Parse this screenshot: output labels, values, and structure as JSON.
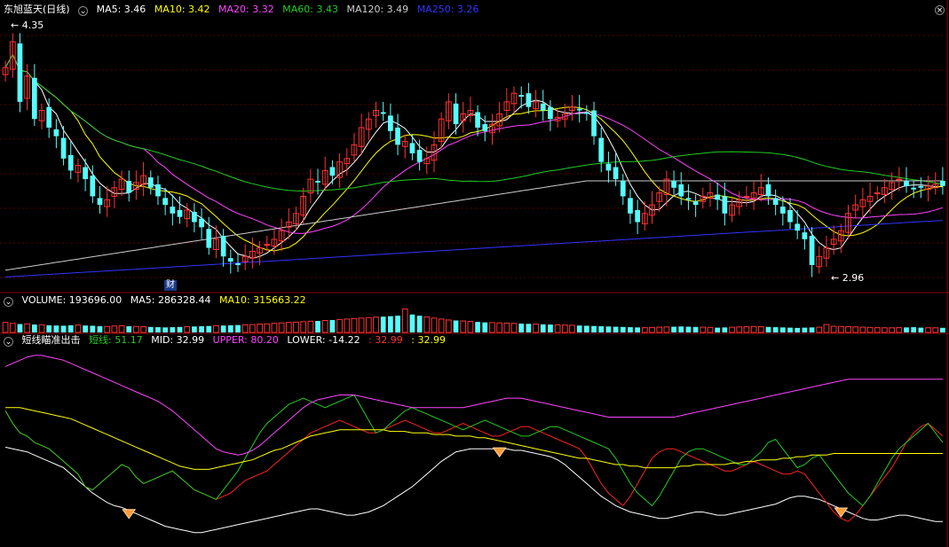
{
  "colors": {
    "up": "#ff3333",
    "down": "#55ffff",
    "ma5": "#ffffff",
    "ma10": "#ffff00",
    "ma20": "#ff44ff",
    "ma60": "#22cc22",
    "ma120": "#cccccc",
    "ma250": "#3333ff",
    "grid": "#5a0000",
    "border": "#8b0000"
  },
  "price_header": {
    "title": "东旭蓝天",
    "period": "(日线)",
    "ma5": "MA5: 3.46",
    "ma10": "MA10: 3.42",
    "ma20": "MA20: 3.32",
    "ma60": "MA60: 3.43",
    "ma120": "MA120: 3.49",
    "ma250": "MA250: 3.26"
  },
  "price_annotations": {
    "high": "4.35",
    "low": "2.96",
    "finance_badge": "财"
  },
  "volume_header": {
    "volume": "VOLUME: 193696.00",
    "ma5": "MA5: 286328.44",
    "ma10": "MA10: 315663.22"
  },
  "indicator_header": {
    "name": "短线瞄准出击",
    "short": "短线: 51.17",
    "mid": "MID: 32.99",
    "upper": "UPPER: 80.20",
    "lower": "LOWER: -14.22",
    "v1": ": 32.99",
    "v2": ": 32.99"
  },
  "chart_data": [
    {
      "type": "candlestick",
      "panel": "price",
      "ylim": [
        2.85,
        4.45
      ],
      "count": 130,
      "close": [
        4.15,
        4.3,
        3.95,
        4.1,
        3.85,
        3.9,
        3.8,
        3.75,
        3.62,
        3.55,
        3.58,
        3.5,
        3.4,
        3.35,
        3.38,
        3.45,
        3.5,
        3.42,
        3.48,
        3.52,
        3.45,
        3.4,
        3.35,
        3.3,
        3.28,
        3.32,
        3.25,
        3.22,
        3.1,
        3.15,
        3.05,
        3.02,
        3.0,
        3.05,
        3.08,
        3.1,
        3.12,
        3.15,
        3.2,
        3.25,
        3.3,
        3.4,
        3.5,
        3.48,
        3.55,
        3.52,
        3.6,
        3.62,
        3.7,
        3.8,
        3.85,
        3.9,
        3.88,
        3.78,
        3.7,
        3.72,
        3.65,
        3.6,
        3.62,
        3.7,
        3.85,
        3.95,
        3.82,
        3.88,
        3.9,
        3.8,
        3.78,
        3.82,
        3.88,
        3.95,
        4.0,
        3.98,
        3.92,
        3.95,
        3.9,
        3.85,
        3.86,
        3.88,
        3.92,
        3.9,
        3.88,
        3.75,
        3.6,
        3.55,
        3.5,
        3.4,
        3.3,
        3.25,
        3.3,
        3.35,
        3.42,
        3.5,
        3.45,
        3.4,
        3.38,
        3.35,
        3.4,
        3.42,
        3.38,
        3.3,
        3.35,
        3.38,
        3.4,
        3.42,
        3.45,
        3.4,
        3.35,
        3.3,
        3.25,
        3.2,
        3.15,
        3.0,
        3.05,
        3.1,
        3.15,
        3.2,
        3.3,
        3.35,
        3.38,
        3.4,
        3.42,
        3.45,
        3.48,
        3.5,
        3.46,
        3.44,
        3.45,
        3.46,
        3.47,
        3.46
      ],
      "annotations": {
        "high": 4.35,
        "low": 2.96
      }
    },
    {
      "type": "bar",
      "panel": "volume",
      "ylim": [
        0,
        1000000
      ],
      "values": [
        420000,
        380000,
        350000,
        360000,
        330000,
        320000,
        300000,
        290000,
        280000,
        300000,
        310000,
        290000,
        280000,
        260000,
        250000,
        270000,
        280000,
        260000,
        250000,
        240000,
        230000,
        220000,
        210000,
        220000,
        230000,
        240000,
        250000,
        260000,
        270000,
        280000,
        290000,
        300000,
        310000,
        320000,
        330000,
        350000,
        360000,
        380000,
        400000,
        420000,
        430000,
        450000,
        470000,
        480000,
        500000,
        520000,
        540000,
        560000,
        580000,
        600000,
        620000,
        640000,
        660000,
        680000,
        700000,
        980000,
        750000,
        700000,
        650000,
        600000,
        560000,
        520000,
        500000,
        480000,
        460000,
        440000,
        420000,
        410000,
        400000,
        390000,
        380000,
        370000,
        360000,
        350000,
        340000,
        330000,
        320000,
        310000,
        300000,
        290000,
        280000,
        270000,
        260000,
        250000,
        240000,
        230000,
        220000,
        210000,
        200000,
        210000,
        220000,
        230000,
        240000,
        250000,
        240000,
        230000,
        220000,
        210000,
        200000,
        210000,
        220000,
        230000,
        240000,
        250000,
        240000,
        230000,
        220000,
        210000,
        200000,
        190000,
        200000,
        210000,
        220000,
        330000,
        260000,
        250000,
        240000,
        230000,
        220000,
        210000,
        200000,
        195000,
        193696,
        200000,
        210000,
        220000,
        200000,
        195000,
        193696,
        193696
      ]
    },
    {
      "type": "line",
      "panel": "indicator",
      "ylim": [
        -25,
        100
      ],
      "count": 130,
      "series": [
        {
          "key": "white",
          "color": "#ffffff",
          "values": [
            37,
            36,
            35,
            34,
            32,
            30,
            28,
            26,
            24,
            20,
            16,
            12,
            8,
            5,
            2,
            0,
            -1,
            -3,
            -5,
            -7,
            -9,
            -11,
            -13,
            -14,
            -15,
            -16,
            -17,
            -17,
            -16,
            -15,
            -14,
            -13,
            -12,
            -11,
            -10,
            -9,
            -8,
            -7,
            -6,
            -5,
            -4,
            -3,
            -2,
            -2,
            -3,
            -4,
            -5,
            -6,
            -6,
            -5,
            -4,
            -2,
            0,
            3,
            6,
            9,
            12,
            16,
            20,
            24,
            28,
            31,
            34,
            35,
            36,
            36,
            36,
            36,
            36,
            36,
            35,
            35,
            34,
            33,
            32,
            31,
            29,
            26,
            22,
            18,
            14,
            10,
            6,
            3,
            0,
            -2,
            -4,
            -5,
            -6,
            -7,
            -8,
            -8,
            -7,
            -6,
            -5,
            -4,
            -4,
            -5,
            -6,
            -6,
            -5,
            -4,
            -3,
            -2,
            -1,
            0,
            1,
            3,
            5,
            6,
            6,
            5,
            4,
            2,
            0,
            -2,
            -4,
            -6,
            -8,
            -9,
            -9,
            -8,
            -7,
            -6,
            -6,
            -7,
            -8,
            -9,
            -10,
            -10
          ]
        },
        {
          "key": "red",
          "color": "#ff2222",
          "values": [
            60,
            52,
            46,
            44,
            40,
            38,
            36,
            32,
            28,
            24,
            20,
            12,
            10,
            14,
            18,
            22,
            26,
            24,
            18,
            14,
            16,
            18,
            20,
            22,
            18,
            14,
            10,
            8,
            6,
            4,
            6,
            8,
            12,
            16,
            18,
            20,
            22,
            26,
            30,
            34,
            38,
            42,
            46,
            48,
            50,
            52,
            54,
            52,
            50,
            48,
            46,
            46,
            48,
            50,
            52,
            54,
            52,
            50,
            48,
            46,
            46,
            48,
            50,
            52,
            50,
            48,
            46,
            44,
            44,
            46,
            48,
            50,
            50,
            48,
            46,
            44,
            42,
            40,
            38,
            36,
            30,
            22,
            14,
            8,
            4,
            0,
            6,
            14,
            22,
            30,
            34,
            36,
            36,
            34,
            32,
            30,
            28,
            26,
            24,
            22,
            22,
            24,
            26,
            28,
            26,
            24,
            22,
            20,
            20,
            22,
            20,
            14,
            8,
            2,
            -4,
            -8,
            -10,
            -6,
            0,
            6,
            12,
            18,
            24,
            32,
            40,
            46,
            50,
            52,
            48,
            44
          ]
        },
        {
          "key": "green",
          "color": "#22cc22",
          "values": [
            60,
            52,
            46,
            44,
            40,
            38,
            36,
            32,
            28,
            24,
            20,
            12,
            10,
            14,
            18,
            22,
            26,
            24,
            18,
            14,
            16,
            18,
            20,
            22,
            18,
            14,
            10,
            8,
            6,
            4,
            10,
            16,
            22,
            30,
            38,
            46,
            52,
            56,
            60,
            64,
            66,
            68,
            66,
            64,
            62,
            64,
            66,
            68,
            70,
            62,
            54,
            46,
            48,
            52,
            56,
            60,
            62,
            60,
            58,
            56,
            54,
            52,
            50,
            48,
            50,
            52,
            54,
            52,
            50,
            48,
            46,
            44,
            44,
            46,
            48,
            50,
            50,
            48,
            46,
            44,
            42,
            40,
            38,
            36,
            30,
            22,
            14,
            8,
            4,
            0,
            6,
            14,
            22,
            30,
            34,
            36,
            36,
            34,
            32,
            30,
            28,
            26,
            26,
            30,
            34,
            40,
            42,
            36,
            30,
            24,
            26,
            30,
            32,
            26,
            20,
            14,
            8,
            4,
            0,
            6,
            14,
            22,
            30,
            36,
            40,
            44,
            48,
            52,
            46,
            40
          ]
        },
        {
          "key": "yellow",
          "color": "#ffff00",
          "values": [
            62,
            62,
            62,
            61,
            60,
            59,
            58,
            57,
            56,
            55,
            53,
            51,
            49,
            47,
            45,
            43,
            41,
            39,
            37,
            35,
            33,
            31,
            29,
            27,
            25,
            24,
            23,
            23,
            23,
            24,
            25,
            26,
            27,
            28,
            29,
            31,
            33,
            35,
            36,
            38,
            40,
            42,
            44,
            45,
            46,
            47,
            48,
            48,
            48,
            48,
            48,
            48,
            48,
            47,
            47,
            47,
            46,
            46,
            46,
            45,
            45,
            45,
            44,
            44,
            44,
            43,
            43,
            42,
            41,
            40,
            39,
            38,
            37,
            36,
            35,
            34,
            33,
            32,
            31,
            30,
            30,
            29,
            28,
            27,
            26,
            26,
            25,
            25,
            24,
            24,
            24,
            24,
            24,
            25,
            25,
            26,
            26,
            26,
            26,
            26,
            27,
            27,
            28,
            28,
            29,
            29,
            29,
            30,
            30,
            31,
            31,
            32,
            32,
            32,
            33,
            33,
            33,
            33,
            33,
            33,
            33,
            33,
            33,
            33,
            33,
            33,
            33,
            33,
            33,
            33
          ]
        },
        {
          "key": "magenta",
          "color": "#ff44ff",
          "values": [
            88,
            90,
            92,
            94,
            95,
            95,
            94,
            93,
            92,
            90,
            88,
            86,
            84,
            82,
            80,
            78,
            76,
            74,
            72,
            70,
            68,
            66,
            63,
            60,
            56,
            52,
            48,
            44,
            40,
            36,
            34,
            33,
            32,
            33,
            35,
            38,
            42,
            46,
            50,
            54,
            58,
            62,
            65,
            67,
            68,
            69,
            70,
            70,
            70,
            69,
            68,
            67,
            66,
            65,
            64,
            63,
            62,
            62,
            62,
            62,
            62,
            62,
            62,
            62,
            63,
            64,
            65,
            66,
            67,
            68,
            68,
            68,
            67,
            66,
            65,
            64,
            63,
            62,
            61,
            60,
            59,
            58,
            57,
            56,
            56,
            56,
            56,
            56,
            56,
            56,
            56,
            56,
            56,
            57,
            58,
            59,
            60,
            61,
            62,
            63,
            64,
            65,
            66,
            67,
            68,
            69,
            70,
            71,
            72,
            73,
            74,
            75,
            76,
            77,
            78,
            79,
            80,
            80,
            80,
            80,
            80,
            80,
            80,
            80,
            80,
            80,
            80,
            80,
            80,
            80
          ]
        }
      ],
      "signal_indices": [
        17,
        68,
        115
      ]
    }
  ]
}
